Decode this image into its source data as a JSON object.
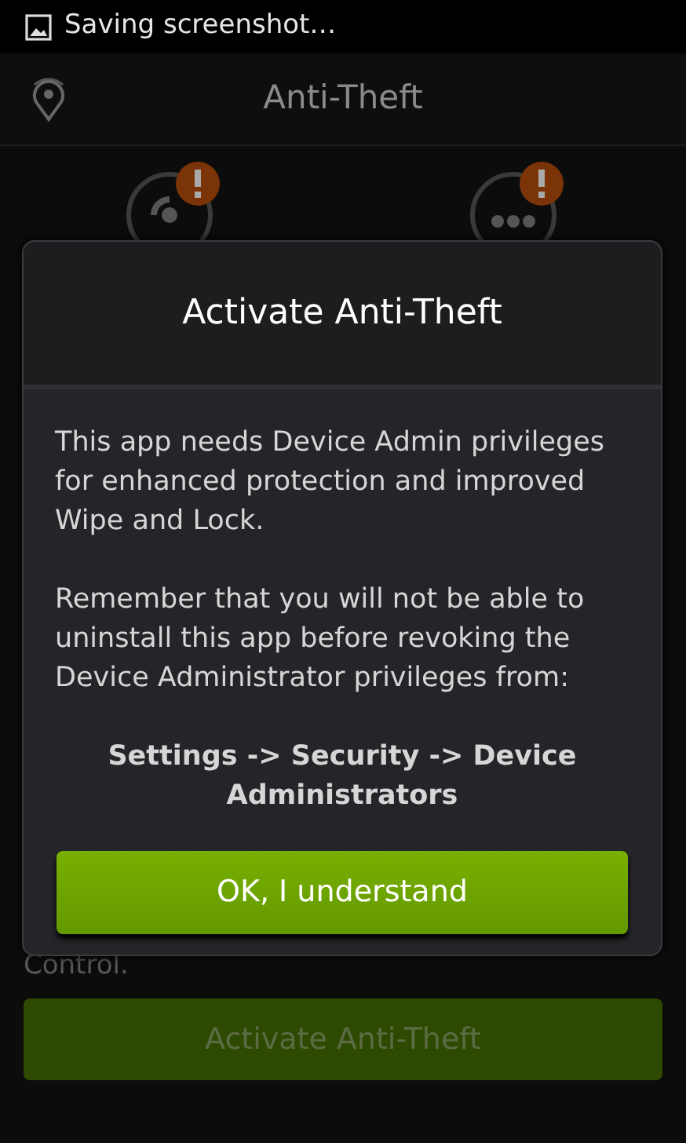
{
  "status_bar": {
    "notification": "Saving screenshot…"
  },
  "app_bar": {
    "title": "Anti-Theft"
  },
  "features": [
    {
      "kind": "signal",
      "alert": true
    },
    {
      "kind": "message",
      "alert": true
    }
  ],
  "background_text": "Control.",
  "activate_button": {
    "label": "Activate Anti-Theft",
    "disabled": true
  },
  "dialog": {
    "title": "Activate Anti-Theft",
    "paragraphs": [
      "This app needs Device Admin privileges for enhanced protection and improved Wipe and Lock.",
      "Remember that you will not be able to uninstall this app before revoking the Device Administrator privileges from:"
    ],
    "path": "Settings -> Security -> Device Administrators",
    "button": "OK, I understand"
  }
}
